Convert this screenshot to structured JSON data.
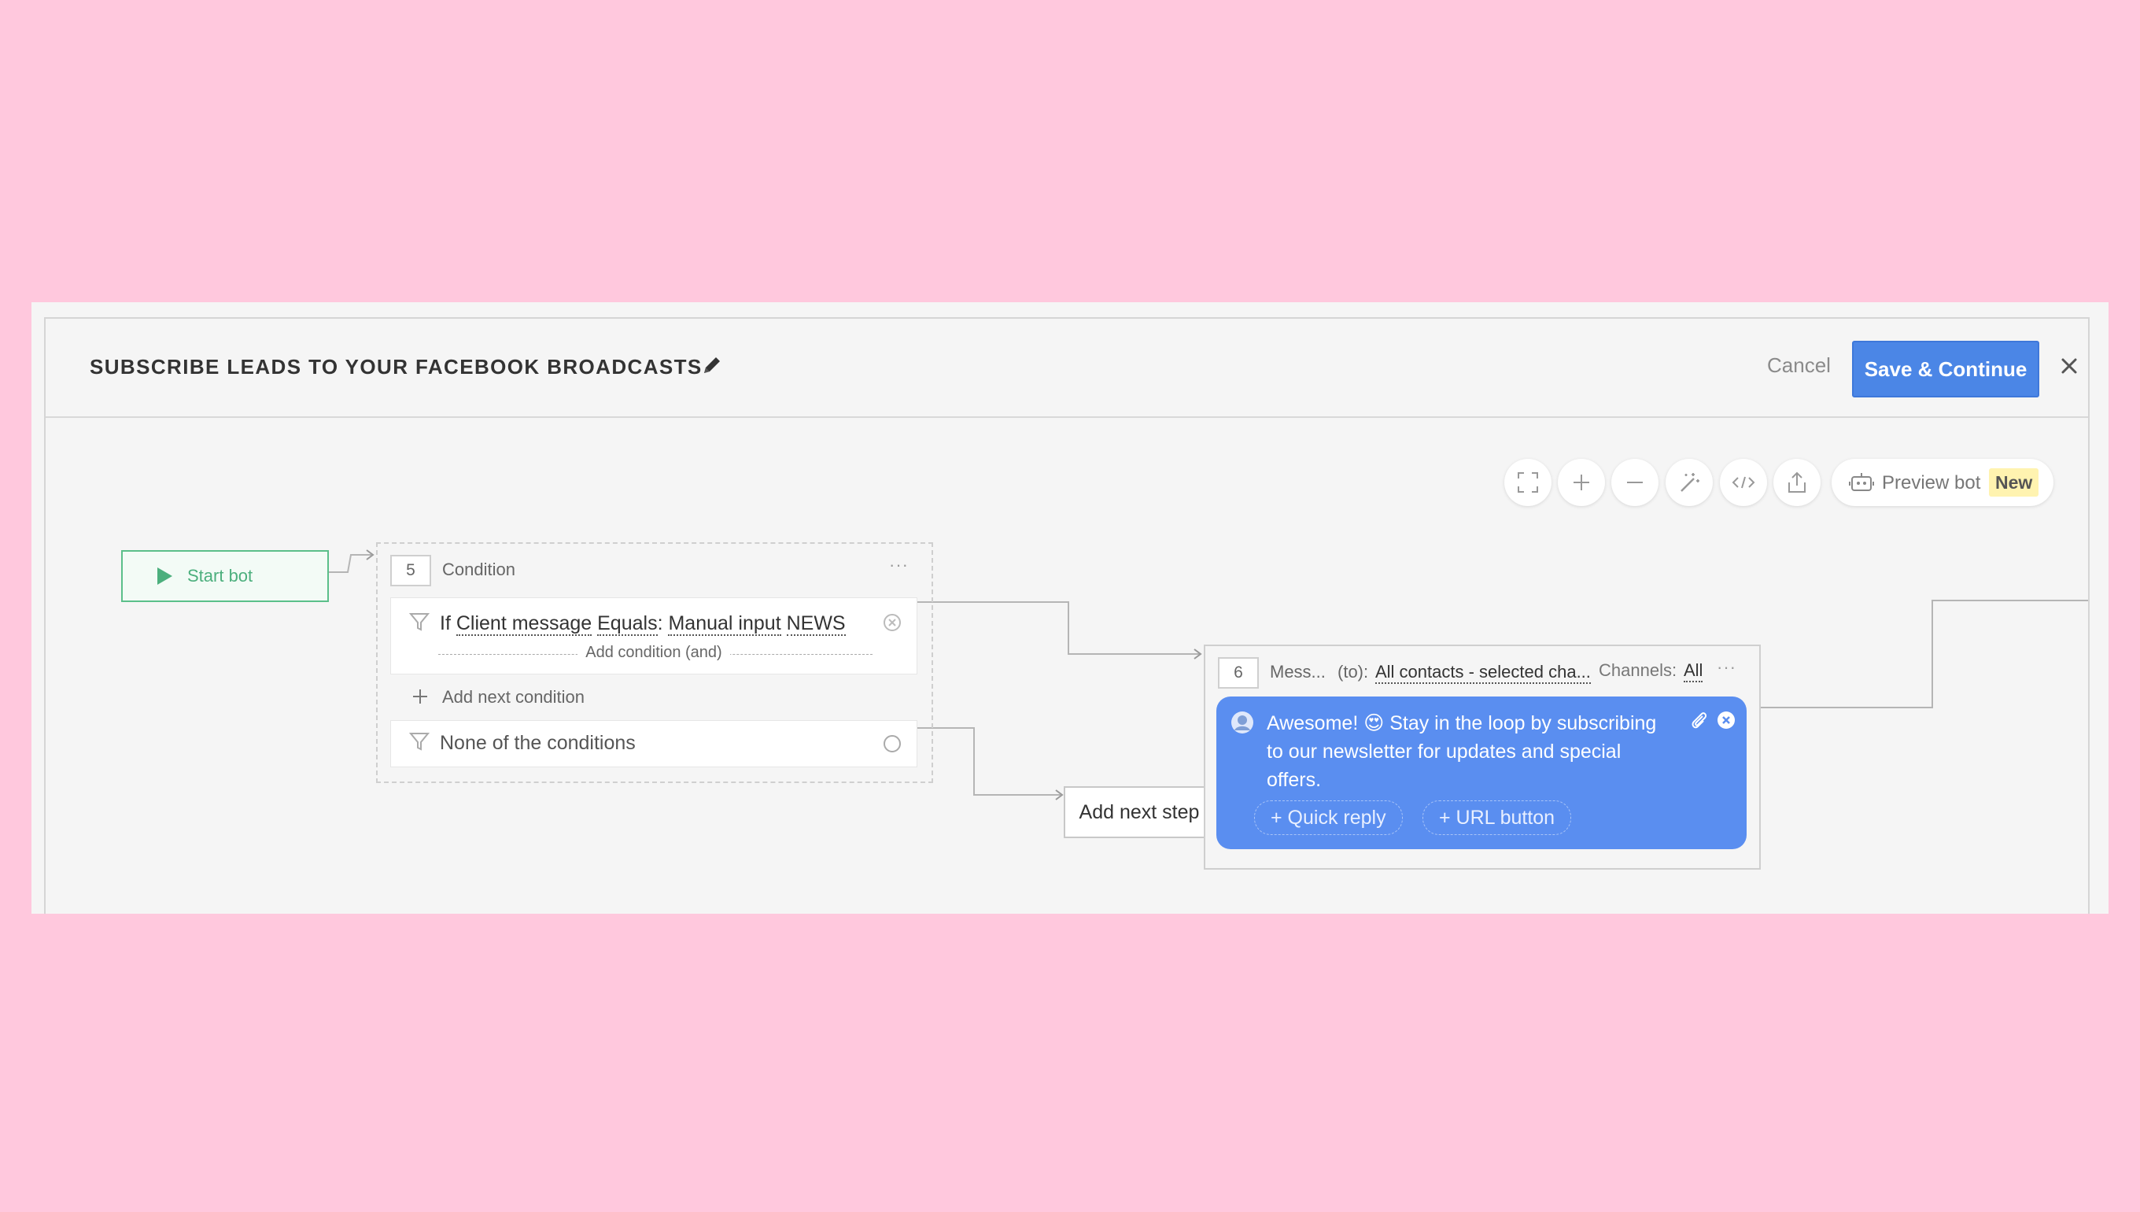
{
  "header": {
    "title": "SUBSCRIBE LEADS TO YOUR FACEBOOK BROADCASTS",
    "cancel_label": "Cancel",
    "save_label": "Save & Continue"
  },
  "toolbar": {
    "icons": [
      "fullscreen-icon",
      "zoom-in-icon",
      "zoom-out-icon",
      "magic-wand-icon",
      "code-icon",
      "share-icon"
    ],
    "preview_label": "Preview bot",
    "preview_badge": "New"
  },
  "start_node": {
    "label": "Start bot"
  },
  "condition_node": {
    "number": "5",
    "title": "Condition",
    "rule": {
      "prefix": "If",
      "field": "Client message",
      "operator": "Equals",
      "source": "Manual input",
      "value": "NEWS"
    },
    "add_condition_label": "Add condition (and)",
    "add_next_condition_label": "Add next condition",
    "none_label": "None of the conditions"
  },
  "add_next_step_label": "Add next step",
  "message_node": {
    "number": "6",
    "title": "Mess...",
    "to_label": "(to):",
    "to_value": "All contacts - selected cha...",
    "channels_label": "Channels:",
    "channels_value": "All",
    "text": "Awesome! 😍 Stay in the loop by subscribing to our newsletter for updates and special offers.",
    "quick_reply_label": "+ Quick reply",
    "url_button_label": "+ URL button"
  },
  "colors": {
    "background": "#ffc8dd",
    "accent": "#4b86e6",
    "bubble": "#5a8ef0",
    "start_green": "#5bbf8a"
  }
}
